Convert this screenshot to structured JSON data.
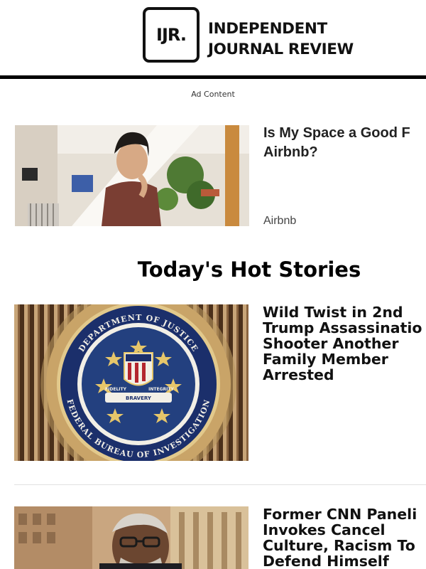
{
  "header": {
    "logo_mark": "IJR.",
    "logo_line1": "INDEPENDENT",
    "logo_line2": "JOURNAL REVIEW"
  },
  "ad": {
    "label": "Ad Content",
    "title_line1": "Is My Space a Good F",
    "title_line2": "Airbnb?",
    "sponsor": "Airbnb"
  },
  "section": {
    "title": "Today's Hot Stories"
  },
  "stories": [
    {
      "title_lines": [
        "Wild Twist in 2nd",
        "Trump Assassinatio",
        "Shooter Another",
        "Family Member",
        "Arrested"
      ],
      "seal_top": "DEPARTMENT OF JUSTICE",
      "seal_bottom": "FEDERAL BUREAU OF INVESTIGATION",
      "seal_ribbon": [
        "FIDELITY",
        "BRAVERY",
        "INTEGRITY"
      ]
    },
    {
      "title_lines": [
        "Former CNN Paneli",
        "Invokes Cancel",
        "Culture, Racism To",
        "Defend Himself"
      ]
    }
  ]
}
